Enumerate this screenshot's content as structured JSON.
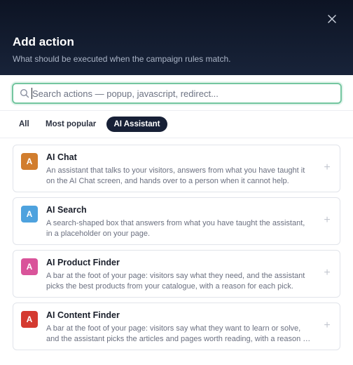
{
  "dialog": {
    "title": "Add action",
    "subtitle": "What should be executed when the campaign rules match.",
    "close_icon": "close-icon"
  },
  "search": {
    "placeholder": "Search actions — popup, javascript, redirect...",
    "value": "",
    "icon": "search-icon",
    "focus_color": "#74c6a0"
  },
  "tabs": [
    {
      "label": "All",
      "active": false
    },
    {
      "label": "Most popular",
      "active": false
    },
    {
      "label": "AI Assistant",
      "active": true
    }
  ],
  "actions": [
    {
      "badge": "A",
      "badge_color": "#d17d2e",
      "title": "AI Chat",
      "description": "An assistant that talks to your visitors, answers from what you have taught it on the AI Chat screen, and hands over to a person when it cannot help.",
      "add_icon": "plus-icon"
    },
    {
      "badge": "A",
      "badge_color": "#4ea2de",
      "title": "AI Search",
      "description": "A search-shaped box that answers from what you have taught the assistant, in a placeholder on your page.",
      "add_icon": "plus-icon"
    },
    {
      "badge": "A",
      "badge_color": "#d9549a",
      "title": "AI Product Finder",
      "description": "A bar at the foot of your page: visitors say what they need, and the assistant picks the best products from your catalogue, with a reason for each pick.",
      "add_icon": "plus-icon"
    },
    {
      "badge": "A",
      "badge_color": "#d43a30",
      "title": "AI Content Finder",
      "description": "A bar at the foot of your page: visitors say what they want to learn or solve, and the assistant picks the articles and pages worth reading, with a reason for each.",
      "add_icon": "plus-icon"
    }
  ],
  "colors": {
    "header_bg": "#0d1424",
    "active_tab_bg": "#172036",
    "card_border": "#e1e4ea"
  }
}
